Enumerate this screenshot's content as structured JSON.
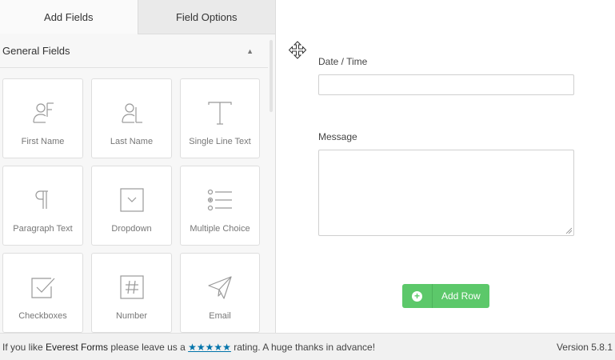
{
  "tabs": {
    "add_fields": "Add Fields",
    "field_options": "Field Options"
  },
  "section": {
    "title": "General Fields",
    "caret": "▲"
  },
  "fields": [
    {
      "label": "First Name",
      "icon": "first-name-icon"
    },
    {
      "label": "Last Name",
      "icon": "last-name-icon"
    },
    {
      "label": "Single Line Text",
      "icon": "single-line-text-icon"
    },
    {
      "label": "Paragraph Text",
      "icon": "paragraph-icon"
    },
    {
      "label": "Dropdown",
      "icon": "dropdown-icon"
    },
    {
      "label": "Multiple Choice",
      "icon": "multiple-choice-icon"
    },
    {
      "label": "Checkboxes",
      "icon": "checkbox-icon"
    },
    {
      "label": "Number",
      "icon": "number-icon"
    },
    {
      "label": "Email",
      "icon": "email-icon"
    }
  ],
  "canvas": {
    "date_label": "Date / Time",
    "message_label": "Message",
    "add_row": "Add Row",
    "add_row_plus": "+"
  },
  "footer": {
    "prefix": "If you like ",
    "brand": "Everest Forms",
    "middle": " please leave us a ",
    "stars": "★★★★★",
    "suffix": " rating. A huge thanks in advance!",
    "version": "Version 5.8.1"
  },
  "colors": {
    "accent": "#5cc86a",
    "link": "#0073aa",
    "icon": "#999999"
  }
}
